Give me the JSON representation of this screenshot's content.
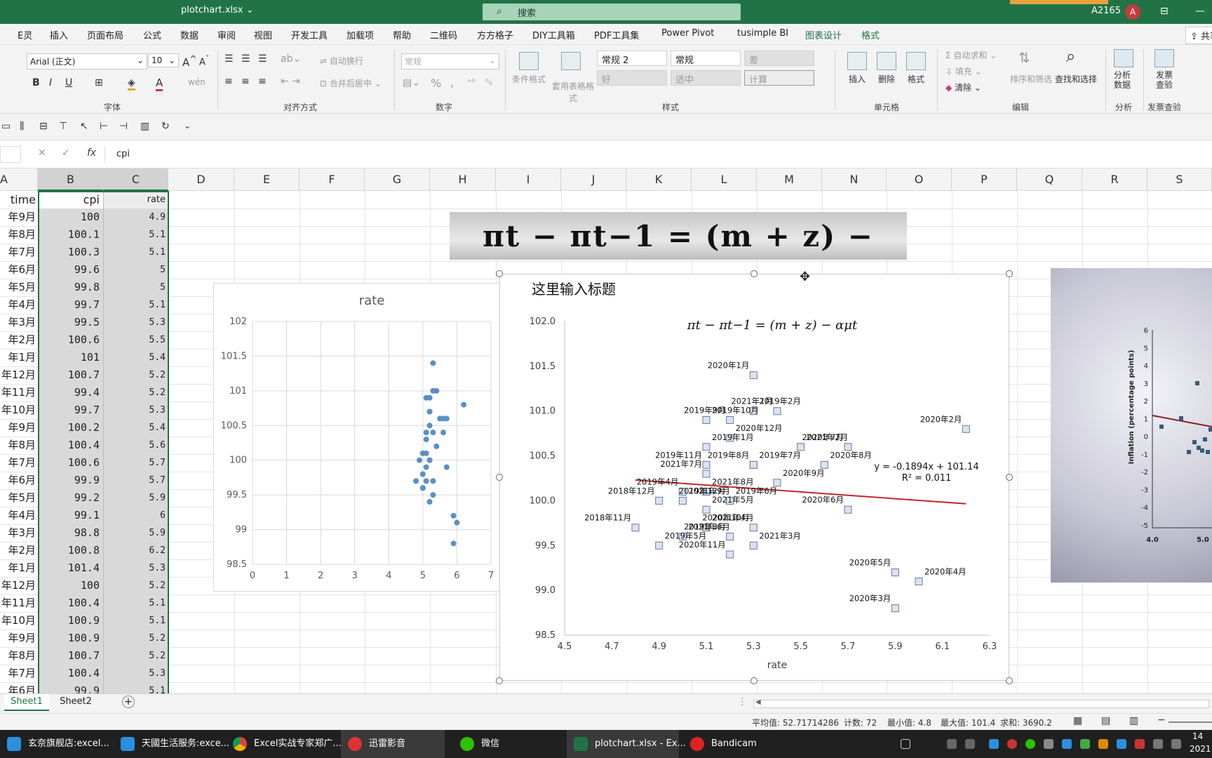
{
  "titlebar": {
    "filename": "plotchart.xlsx ⌄",
    "search_placeholder": "搜索",
    "user": "A2165",
    "avatar": "A"
  },
  "menu": [
    "E灵",
    "插入",
    "页面布局",
    "公式",
    "数据",
    "审阅",
    "视图",
    "开发工具",
    "加载项",
    "帮助",
    "二维码",
    "方方格子",
    "DIY工具箱",
    "PDF工具集",
    "Power Pivot",
    "tusimple BI",
    "图表设计",
    "格式"
  ],
  "share_label": "共享",
  "ribbon": {
    "font_name": "Arial (正文)",
    "font_size": "10",
    "wrap_label": "自动换行",
    "merge_label": "合并后居中",
    "number_format": "常规",
    "cond_format": "条件格式",
    "table_format": "套用表格格式",
    "styles": [
      "常规 2",
      "常规",
      "差",
      "好",
      "适中",
      "计算"
    ],
    "insert": "插入",
    "delete": "删除",
    "format": "格式",
    "autosum": "自动求和",
    "fill": "填充",
    "clear": "清除",
    "sort": "排序和筛选",
    "find": "查找和选择",
    "analyze": "分析数据",
    "invoice": "发票查验",
    "groups": {
      "font": "字体",
      "align": "对齐方式",
      "number": "数字",
      "styles": "样式",
      "cells": "单元格",
      "edit": "编辑",
      "analysis": "分析",
      "invoice": "发票查验"
    }
  },
  "formula": {
    "value": "cpi"
  },
  "columns": [
    "A",
    "B",
    "C",
    "D",
    "E",
    "F",
    "G",
    "H",
    "I",
    "J",
    "K",
    "L",
    "M",
    "N",
    "O",
    "P",
    "Q",
    "R",
    "S"
  ],
  "table": {
    "headers": {
      "a": "time",
      "b": "cpi",
      "c": "rate"
    },
    "rows": [
      {
        "a": "年9月",
        "b": "100",
        "c": "4.9"
      },
      {
        "a": "年8月",
        "b": "100.1",
        "c": "5.1"
      },
      {
        "a": "年7月",
        "b": "100.3",
        "c": "5.1"
      },
      {
        "a": "年6月",
        "b": "99.6",
        "c": "5"
      },
      {
        "a": "年5月",
        "b": "99.8",
        "c": "5"
      },
      {
        "a": "年4月",
        "b": "99.7",
        "c": "5.1"
      },
      {
        "a": "年3月",
        "b": "99.5",
        "c": "5.3"
      },
      {
        "a": "年2月",
        "b": "100.6",
        "c": "5.5"
      },
      {
        "a": "年1月",
        "b": "101",
        "c": "5.4"
      },
      {
        "a": "年12月",
        "b": "100.7",
        "c": "5.2"
      },
      {
        "a": "年11月",
        "b": "99.4",
        "c": "5.2"
      },
      {
        "a": "年10月",
        "b": "99.7",
        "c": "5.3"
      },
      {
        "a": "年9月",
        "b": "100.2",
        "c": "5.4"
      },
      {
        "a": "年8月",
        "b": "100.4",
        "c": "5.6"
      },
      {
        "a": "年7月",
        "b": "100.6",
        "c": "5.7"
      },
      {
        "a": "年6月",
        "b": "99.9",
        "c": "5.7"
      },
      {
        "a": "年5月",
        "b": "99.2",
        "c": "5.9"
      },
      {
        "a": "年4月",
        "b": "99.1",
        "c": "6"
      },
      {
        "a": "年3月",
        "b": "98.8",
        "c": "5.9"
      },
      {
        "a": "年2月",
        "b": "100.8",
        "c": "6.2"
      },
      {
        "a": "年1月",
        "b": "101.4",
        "c": "5.3"
      },
      {
        "a": "年12月",
        "b": "100",
        "c": "5.2"
      },
      {
        "a": "年11月",
        "b": "100.4",
        "c": "5.1"
      },
      {
        "a": "年10月",
        "b": "100.9",
        "c": "5.1"
      },
      {
        "a": "年9月",
        "b": "100.9",
        "c": "5.2"
      },
      {
        "a": "年8月",
        "b": "100.7",
        "c": "5.2"
      },
      {
        "a": "年7月",
        "b": "100.4",
        "c": "5.3"
      },
      {
        "a": "年6月",
        "b": "99.9",
        "c": "5.1"
      }
    ]
  },
  "equation_image_text": "πt − πt−1 = (m + z) − αut",
  "chart_data": [
    {
      "type": "scatter",
      "title": "rate",
      "xlim": [
        0,
        7
      ],
      "ylim": [
        98.5,
        102
      ],
      "xticks": [
        "0",
        "1",
        "2",
        "3",
        "4",
        "5",
        "6",
        "7"
      ],
      "yticks": [
        "98.5",
        "99",
        "99.5",
        "100",
        "100.5",
        "101",
        "101.5",
        "102"
      ],
      "grid": true,
      "points": [
        [
          4.9,
          100
        ],
        [
          5.1,
          100.1
        ],
        [
          5.1,
          100.3
        ],
        [
          5,
          99.6
        ],
        [
          5,
          99.8
        ],
        [
          5.1,
          99.7
        ],
        [
          5.3,
          99.5
        ],
        [
          5.5,
          100.6
        ],
        [
          5.4,
          101
        ],
        [
          5.2,
          100.7
        ],
        [
          5.2,
          99.4
        ],
        [
          5.3,
          99.7
        ],
        [
          5.4,
          100.2
        ],
        [
          5.6,
          100.4
        ],
        [
          5.7,
          100.6
        ],
        [
          5.7,
          99.9
        ],
        [
          5.9,
          99.2
        ],
        [
          6,
          99.1
        ],
        [
          5.9,
          98.8
        ],
        [
          6.2,
          100.8
        ],
        [
          5.3,
          101.4
        ],
        [
          5.2,
          100
        ],
        [
          5.1,
          100.4
        ],
        [
          5.1,
          100.9
        ],
        [
          5.2,
          100.9
        ],
        [
          5.2,
          100.7
        ],
        [
          5.3,
          100.4
        ],
        [
          5.1,
          99.9
        ],
        [
          4.8,
          99.7
        ],
        [
          5,
          99.6
        ],
        [
          5.2,
          100
        ],
        [
          5,
          100.1
        ],
        [
          5.3,
          101
        ],
        [
          5.6,
          100.6
        ],
        [
          5.2,
          100.5
        ],
        [
          5,
          100.1
        ]
      ],
      "color": "#5b8fc4"
    },
    {
      "type": "scatter",
      "title": "这里输入标题",
      "subtitle": "πt − πt−1 = (m + z) − αμt",
      "xlabel": "rate",
      "xlim": [
        4.5,
        6.3
      ],
      "ylim": [
        98.5,
        102
      ],
      "xticks": [
        "4.5",
        "4.7",
        "4.9",
        "5.1",
        "5.3",
        "5.5",
        "5.7",
        "5.9",
        "6.1",
        "6.3"
      ],
      "yticks": [
        "98.5",
        "99.0",
        "99.5",
        "100.0",
        "100.5",
        "101.0",
        "101.5",
        "102.0"
      ],
      "trendline": {
        "equation": "y = -0.1894x + 101.14",
        "r2": "R² = 0.011",
        "slope": -0.1894,
        "intercept": 101.14,
        "x_range": [
          4.8,
          6.2
        ],
        "color": "#c0272d"
      },
      "points": [
        {
          "x": 5.3,
          "y": 101.4,
          "label": "2020年1月"
        },
        {
          "x": 5.3,
          "y": 101.0,
          "label": "2019年2月"
        },
        {
          "x": 5.4,
          "y": 101.0,
          "label": "2021年1月"
        },
        {
          "x": 5.1,
          "y": 100.9,
          "label": "2019年10月"
        },
        {
          "x": 5.2,
          "y": 100.9,
          "label": "2019年9月"
        },
        {
          "x": 5.2,
          "y": 100.7,
          "label": "2020年12月"
        },
        {
          "x": 6.2,
          "y": 100.8,
          "label": "2020年2月"
        },
        {
          "x": 5.5,
          "y": 100.6,
          "label": "2021年2月"
        },
        {
          "x": 5.7,
          "y": 100.6,
          "label": "2020年7月"
        },
        {
          "x": 5.1,
          "y": 100.6,
          "label": "2019年1月"
        },
        {
          "x": 5.3,
          "y": 100.4,
          "label": "2019年8月"
        },
        {
          "x": 5.6,
          "y": 100.4,
          "label": "2020年8月"
        },
        {
          "x": 5.1,
          "y": 100.4,
          "label": "2019年11月"
        },
        {
          "x": 5.3,
          "y": 100.4,
          "label": "2019年7月"
        },
        {
          "x": 5.1,
          "y": 100.3,
          "label": "2021年7月"
        },
        {
          "x": 5.4,
          "y": 100.2,
          "label": "2020年9月"
        },
        {
          "x": 5.0,
          "y": 100.1,
          "label": "2019年4月"
        },
        {
          "x": 5.1,
          "y": 100.1,
          "label": "2021年8月"
        },
        {
          "x": 4.9,
          "y": 100.0,
          "label": "2018年12月"
        },
        {
          "x": 5.0,
          "y": 100.0,
          "label": "2021年9月"
        },
        {
          "x": 5.2,
          "y": 100.0,
          "label": "2019年12月"
        },
        {
          "x": 5.2,
          "y": 100.0,
          "label": "2019年6月"
        },
        {
          "x": 5.7,
          "y": 99.9,
          "label": "2020年6月"
        },
        {
          "x": 5.1,
          "y": 99.9,
          "label": "2021年5月"
        },
        {
          "x": 4.8,
          "y": 99.7,
          "label": "2018年11月"
        },
        {
          "x": 5.1,
          "y": 99.7,
          "label": "2021年4月"
        },
        {
          "x": 5.3,
          "y": 99.7,
          "label": "2020年10月"
        },
        {
          "x": 5.0,
          "y": 99.6,
          "label": "2021年6月"
        },
        {
          "x": 5.2,
          "y": 99.6,
          "label": "2019年3月"
        },
        {
          "x": 5.3,
          "y": 99.5,
          "label": "2021年3月"
        },
        {
          "x": 5.2,
          "y": 99.4,
          "label": "2020年11月"
        },
        {
          "x": 4.9,
          "y": 99.5,
          "label": "2019年5月"
        },
        {
          "x": 5.9,
          "y": 99.2,
          "label": "2020年5月"
        },
        {
          "x": 6.0,
          "y": 99.1,
          "label": "2020年4月"
        },
        {
          "x": 5.9,
          "y": 98.8,
          "label": "2020年3月"
        }
      ]
    }
  ],
  "photo": {
    "ylabel": "Inflation (percentage points)",
    "yticks": [
      "6",
      "5",
      "4",
      "3",
      "2",
      "1",
      "0",
      "-1",
      "-2",
      "-3",
      "-4",
      "-5"
    ],
    "xticks": [
      "4.0",
      "5.0"
    ]
  },
  "tabs": [
    "Sheet1",
    "Sheet2"
  ],
  "add_sheet": "+",
  "status": {
    "avg": "平均值: 52.71714286",
    "count": "计数: 72",
    "min": "最小值: 4.8",
    "max": "最大值: 101.4",
    "sum": "求和: 3690.2"
  },
  "taskbar": {
    "items": [
      "玄奈旗舰店:excel...",
      "天國生活服务:exce...",
      "Excel实战专家郑广...",
      "迅雷影音",
      "微信",
      "plotchart.xlsx - Ex...",
      "Bandicam"
    ],
    "clock_time": "14",
    "clock_date": "2021"
  },
  "colors": {
    "excel_green": "#217346",
    "point_blue": "#5b8fc4",
    "trend_red": "#c0272d"
  }
}
